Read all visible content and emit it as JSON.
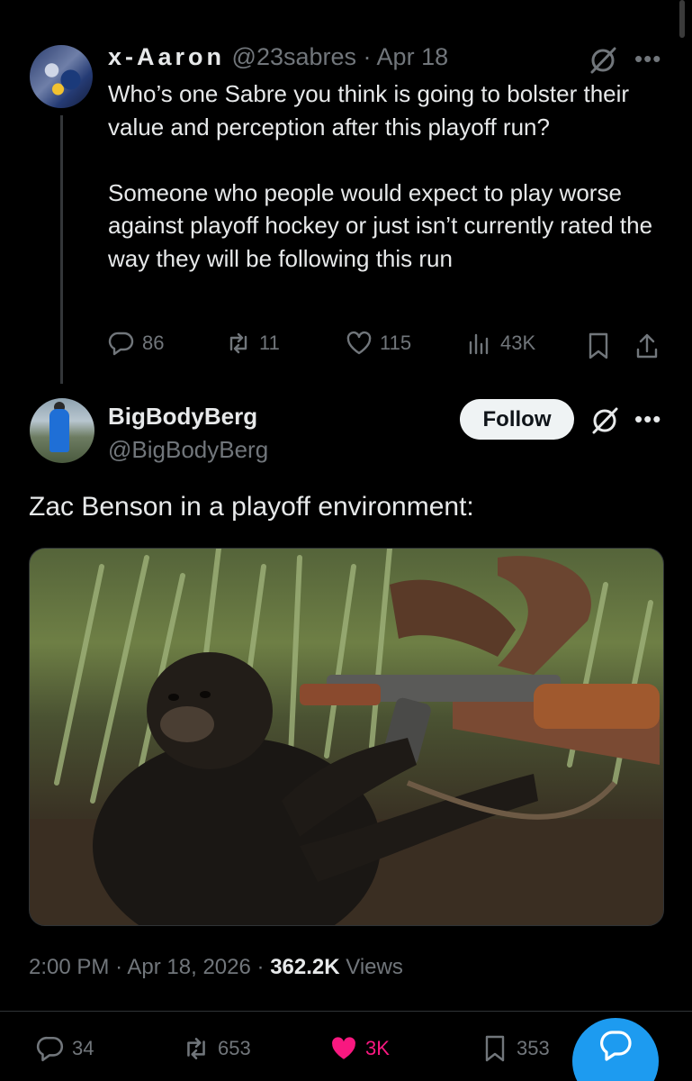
{
  "parent_tweet": {
    "display_name": "x-Aaron",
    "handle": "@23sabres",
    "separator": "·",
    "date": "Apr 18",
    "text": "Who’s one Sabre you think is going to bolster their value and perception after this playoff run?\n\nSomeone who people would expect to play worse against playoff hockey or just isn’t currently rated the way they will be following this run",
    "replies": "86",
    "reposts": "11",
    "likes": "115",
    "views": "43K"
  },
  "main_tweet": {
    "display_name": "BigBodyBerg",
    "handle": "@BigBodyBerg",
    "follow_label": "Follow",
    "text": "Zac Benson in a playoff environment:",
    "media_description_icon": "video-thumbnail",
    "time": "2:00 PM",
    "date": "Apr 18, 2026",
    "views_count": "362.2K",
    "views_label": "Views",
    "replies": "34",
    "reposts": "653",
    "likes": "3K",
    "bookmarks": "353"
  },
  "colors": {
    "background": "#000000",
    "text_primary": "#e7e9ea",
    "text_secondary": "#71767b",
    "like_active": "#f91880",
    "accent": "#1d9bf0"
  },
  "icons": {
    "reply": "reply-icon",
    "repost": "repost-icon",
    "like": "heart-icon",
    "views": "views-icon",
    "bookmark": "bookmark-icon",
    "share": "share-icon",
    "grok": "grok-icon",
    "more": "more-icon",
    "compose": "compose-reply-icon"
  }
}
